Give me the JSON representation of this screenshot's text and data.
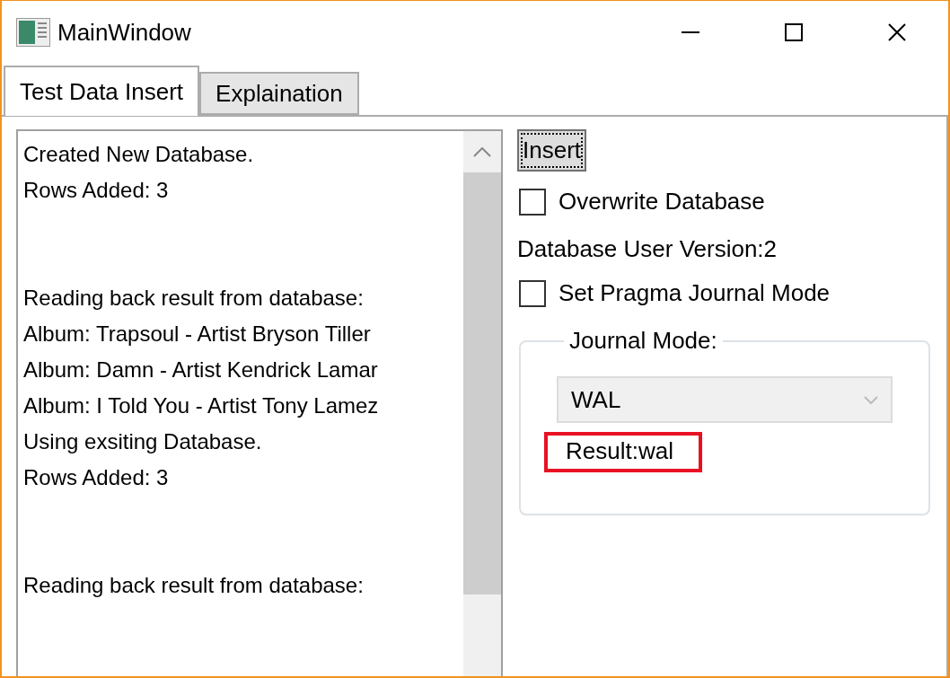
{
  "window": {
    "title": "MainWindow"
  },
  "tabs": [
    {
      "label": "Test Data Insert",
      "selected": true
    },
    {
      "label": "Explaination",
      "selected": false
    }
  ],
  "log": {
    "blocks": [
      [
        "Created New Database.",
        "Rows Added: 3"
      ],
      [
        "Reading back result from database:",
        "Album: Trapsoul - Artist Bryson Tiller",
        "Album: Damn - Artist Kendrick Lamar",
        "Album: I Told You - Artist Tony Lamez",
        "Using exsiting Database.",
        "Rows Added: 3"
      ],
      [
        "Reading back result from database:"
      ]
    ]
  },
  "insert_button": {
    "label": "Insert",
    "focused": true
  },
  "overwrite": {
    "label": "Overwrite Database",
    "checked": false
  },
  "user_version": "Database User Version:2",
  "pragma": {
    "label": "Set Pragma Journal Mode",
    "checked": false
  },
  "journal_mode": {
    "legend": "Journal Mode:",
    "value": "WAL",
    "result": "Result:wal",
    "highlighted": true
  }
}
